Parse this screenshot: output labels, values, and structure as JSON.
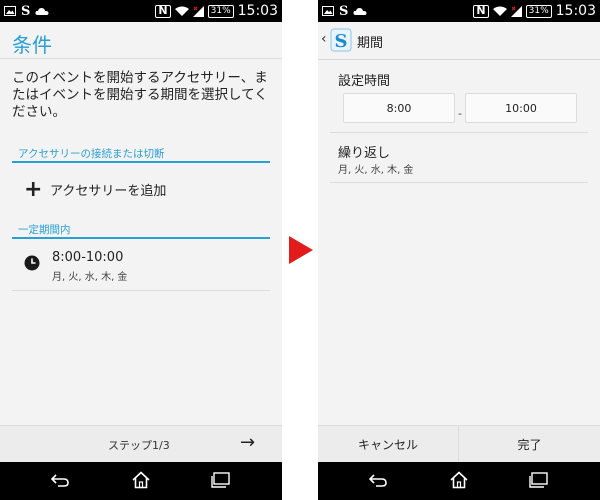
{
  "status_bar": {
    "time": "15:03",
    "battery": "31%"
  },
  "left_screen": {
    "title": "条件",
    "description": "このイベントを開始するアクセサリー、またはイベントを開始する期間を選択してください。",
    "section_accessory": "アクセサリーの接続または切断",
    "add_accessory": "アクセサリーを追加",
    "section_period": "一定期間内",
    "period_time": "8:00-10:00",
    "period_days": "月, 火, 水, 木, 金",
    "step": "ステップ1/3"
  },
  "right_screen": {
    "title": "期間",
    "set_time_label": "設定時間",
    "start_time": "8:00",
    "time_separator": "-",
    "end_time": "10:00",
    "repeat_label": "繰り返し",
    "repeat_days": "月, 火, 水, 木, 金",
    "cancel": "キャンセル",
    "done": "完了"
  },
  "icons": [
    "image-icon",
    "s-app-icon",
    "cloud-icon",
    "nfc-icon",
    "wifi-icon",
    "signal-icon",
    "battery-icon",
    "plus-icon",
    "clock-icon",
    "arrow-right-icon",
    "back-icon",
    "home-icon",
    "recent-apps-icon",
    "chevron-left-icon",
    "app-logo-icon",
    "transition-arrow-icon"
  ],
  "colors": {
    "accent": "#2a9fd6",
    "transition_arrow": "#e21b1b",
    "background": "#f3f3f3",
    "bars": "#000000"
  }
}
